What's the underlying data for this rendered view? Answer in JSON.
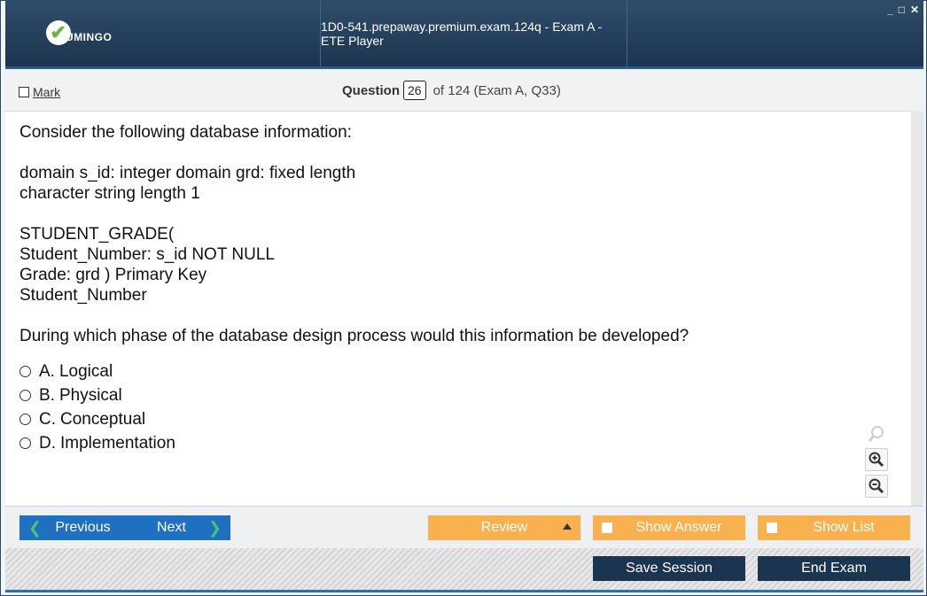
{
  "window": {
    "title": "1D0-541.prepaway.premium.exam.124q - Exam A - ETE Player",
    "controls": [
      "_",
      "□",
      "✕"
    ]
  },
  "logo": {
    "mark": "✔",
    "text": "UMINGO"
  },
  "question_bar": {
    "mark_label": "Mark",
    "question_label": "Question",
    "question_number": "26",
    "of_text": "of 124 (Exam A, Q33)"
  },
  "question": {
    "lines": [
      "Consider the following database information:",
      "",
      "domain s_id: integer domain grd: fixed length",
      "character string length 1",
      "",
      "STUDENT_GRADE(",
      "Student_Number: s_id NOT NULL",
      "Grade: grd ) Primary Key",
      "Student_Number",
      "",
      "During which phase of the database design process would this information be developed?"
    ]
  },
  "answers": [
    {
      "letter": "A.",
      "text": "Logical"
    },
    {
      "letter": "B.",
      "text": "Physical"
    },
    {
      "letter": "C.",
      "text": "Conceptual"
    },
    {
      "letter": "D.",
      "text": "Implementation"
    }
  ],
  "zoom": {
    "icons": [
      "search-icon",
      "zoom-in-icon",
      "zoom-out-icon"
    ]
  },
  "nav": {
    "previous": "Previous",
    "next": "Next",
    "review": "Review",
    "show_answer": "Show Answer",
    "show_list": "Show List",
    "save_session": "Save Session",
    "end_exam": "End Exam"
  },
  "colors": {
    "title_bar": "#1c3550",
    "nav_blue": "#1f70c1",
    "nav_orange": "#f9b150",
    "dark_button": "#1b3550",
    "accent_green": "#49c27a"
  }
}
